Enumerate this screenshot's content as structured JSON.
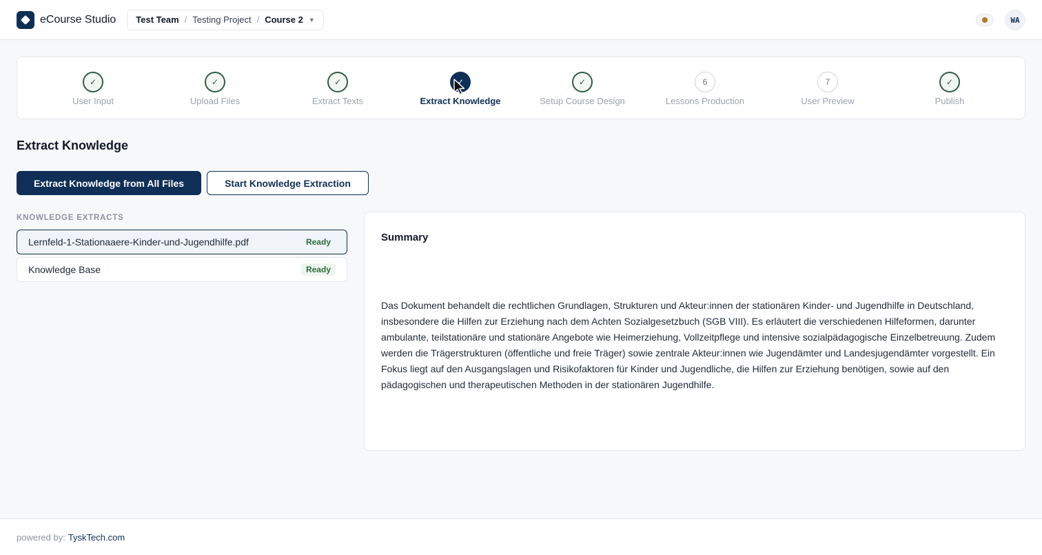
{
  "app": {
    "name": "eCourse Studio",
    "logo_icon": "diamond-logo-icon"
  },
  "breadcrumb": {
    "team": "Test Team",
    "project": "Testing Project",
    "course": "Course 2",
    "separator": "/"
  },
  "header": {
    "avatar_initials": "WA",
    "status_color": "#b7791f"
  },
  "steps": [
    {
      "label": "User Input",
      "state": "done",
      "marker": "✓"
    },
    {
      "label": "Upload Files",
      "state": "done",
      "marker": "✓"
    },
    {
      "label": "Extract Texts",
      "state": "done",
      "marker": "✓"
    },
    {
      "label": "Extract Knowledge",
      "state": "active",
      "marker": "✓"
    },
    {
      "label": "Setup Course Design",
      "state": "done",
      "marker": "✓"
    },
    {
      "label": "Lessons Production",
      "state": "pending",
      "marker": "6"
    },
    {
      "label": "User Preview",
      "state": "pending",
      "marker": "7"
    },
    {
      "label": "Publish",
      "state": "done",
      "marker": "✓"
    }
  ],
  "main": {
    "title": "Extract Knowledge",
    "primary_button": "Extract Knowledge from All Files",
    "secondary_button": "Start Knowledge Extraction",
    "extracts_heading": "KNOWLEDGE EXTRACTS",
    "extracts": [
      {
        "name": "Lernfeld-1-Stationaaere-Kinder-und-Jugendhilfe.pdf",
        "status": "Ready",
        "selected": true
      },
      {
        "name": "Knowledge Base",
        "status": "Ready",
        "selected": false
      }
    ],
    "summary": {
      "title": "Summary",
      "text": "Das Dokument behandelt die rechtlichen Grundlagen, Strukturen und Akteur:innen der stationären Kinder- und Jugendhilfe in Deutschland, insbesondere die Hilfen zur Erziehung nach dem Achten Sozialgesetzbuch (SGB VIII). Es erläutert die verschiedenen Hilfeformen, darunter ambulante, teilstationäre und stationäre Angebote wie Heimerziehung, Vollzeitpflege und intensive sozialpädagogische Einzelbetreuung. Zudem werden die Trägerstrukturen (öffentliche und freie Träger) sowie zentrale Akteur:innen wie Jugendämter und Landesjugendämter vorgestellt. Ein Fokus liegt auf den Ausgangslagen und Risikofaktoren für Kinder und Jugendliche, die Hilfen zur Erziehung benötigen, sowie auf den pädagogischen und therapeutischen Methoden in der stationären Jugendhilfe."
    }
  },
  "footer": {
    "prefix": "powered by:",
    "link": "TyskTech.com"
  },
  "colors": {
    "brand": "#0f2f57",
    "done": "#2f5d46",
    "ready": "#2f6b3e"
  }
}
